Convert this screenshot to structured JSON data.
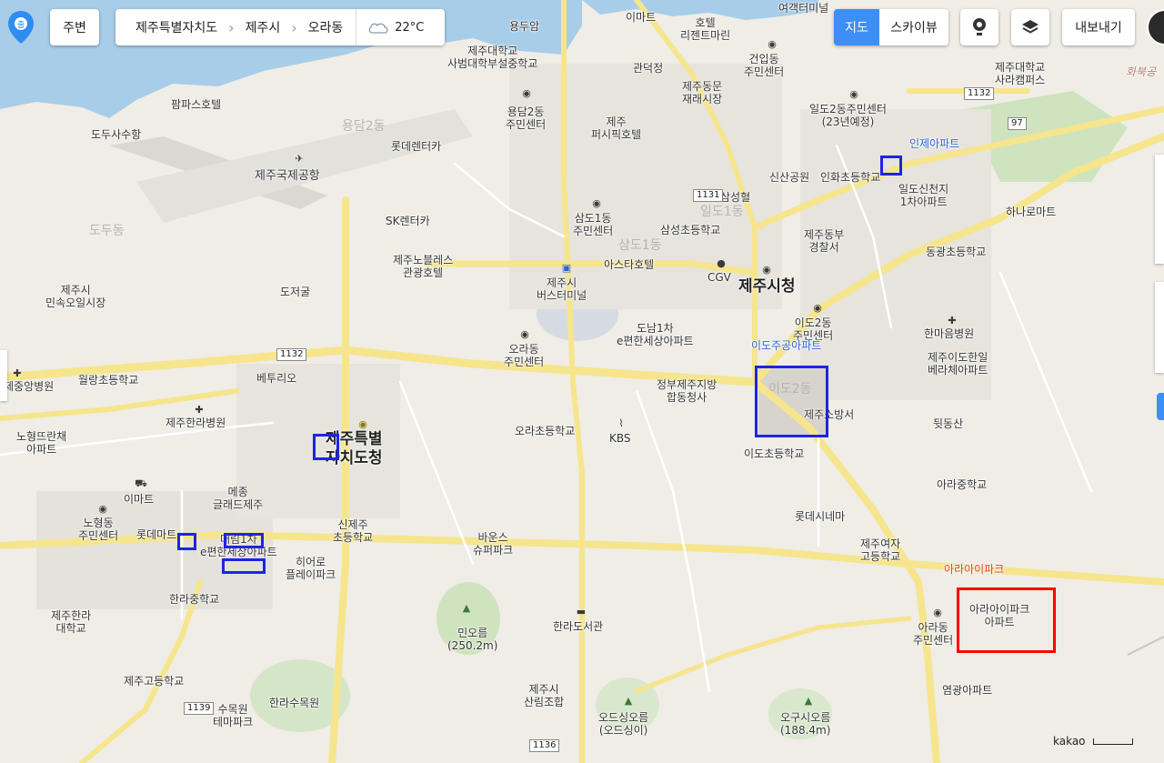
{
  "topbar": {
    "nearby_label": "주변",
    "breadcrumb": [
      "제주특별자치도",
      "제주시",
      "오라동"
    ],
    "weather_temp": "22°C",
    "map_mode_label": "지도",
    "skyview_label": "스카이뷰",
    "export_label": "내보내기"
  },
  "labels": {
    "yongdam_market": "용두암",
    "emart1": "이마트",
    "hotel_regent": "호텔\n리젠트마린",
    "yeogaek": "여객터미널",
    "jnu_school": "제주대학교\n사범대학부설중학교",
    "geonip": "건입동\n주민센터",
    "jnu_sara": "제주대학교\n사라캠퍼스",
    "palm_hotel": "팜파스호텔",
    "gwandeok": "관덕정",
    "dongmun": "제주동문\n재래시장",
    "yongdam2": "용담2동\n주민센터",
    "jeju_pacific": "제주\n퍼시픽호텔",
    "ildo2": "일도2동주민센터\n(23년예정)",
    "dodu_suhang": "도두사수항",
    "lotte_rentcar": "롯데렌터카",
    "inje_apt": "인제아파트",
    "jeju_airport": "제주국제공항",
    "sinsan_park": "신산공원",
    "inhwa_school": "인화초등학교",
    "ildo_sincheonji": "일도신천지\n1차아파트",
    "samsung_hyeol": "삼성혈",
    "sk_rentcar": "SK렌터카",
    "samdo1": "삼도1동\n주민센터",
    "samsung_school": "삼성초등학교",
    "hanaro": "하나로마트",
    "jeju_dongbu": "제주동부\n경찰서",
    "dodu_dong": "도두동",
    "nobless": "제주노블레스\n관광호텔",
    "asta_hotel": "아스타호텔",
    "cgv": "CGV",
    "jeju_city_hall": "제주시청",
    "donggwang_school": "동광초등학교",
    "jeju_market": "제주시\n민속오일시장",
    "dojeogul": "도저굴",
    "bus_terminal": "제주시\n버스터미널",
    "donam1": "도남1차\ne편한세상아파트",
    "ido2_center": "이도2동\n주민센터",
    "hanmaeum": "한마음병원",
    "idojugong": "이도주공아파트",
    "ora_center": "오라동\n주민센터",
    "ido_hanil": "제주이도한일\n베라체아파트",
    "jeju_yangbyeong": "제중앙병원",
    "wolnang_school": "월랑초등학교",
    "betulio": "베투리오",
    "gov_complex": "정부제주지방\n합동청사",
    "jeju_fire": "제주소방서",
    "jeju_hanra_hospital": "제주한라병원",
    "provincial_office": "제주특별\n자치도청",
    "ora_school": "오라초등학교",
    "kbs": "KBS",
    "ido_school": "이도초등학교",
    "dwitdongsan": "뒷동산",
    "nohyeong_ttuan": "노형뜨란채\n아파트",
    "mejong": "메종\n글래드제주",
    "ara_middle": "아라중학교",
    "emart2": "이마트",
    "nohyeong_center": "노형동\n주민센터",
    "lotte_mart": "롯데마트",
    "donam1_apt": "대림1차\ne편한세상아파트",
    "sinjeju_school": "신제주\n초등학교",
    "baunseu": "바운스\n슈퍼파크",
    "lotte_cinema": "롯데시네마",
    "jeju_girls_high": "제주여자\n고등학교",
    "hero_playpark": "히어로\n플레이파크",
    "ara_ipark_red": "아라아이파크",
    "hanra_middle": "한라중학교",
    "jeju_hanra_univ": "제주한라\n대학교",
    "mioreum": "민오름\n(250.2m)",
    "hanra_library": "한라도서관",
    "ara_center": "아라동\n주민센터",
    "ara_ipark_apt": "아라아이파크\n아파트",
    "jeju_goejeong": "제주고등학교",
    "sumok_theme": "수목원\n테마파크",
    "hanra_sumokwon": "한라수목원",
    "jeju_forest": "제주시\n산림조합",
    "odeungsing": "오드싱오름\n(오드싱이)",
    "ogusi": "오구시오름\n(188.4m)",
    "yeomgwang": "염광아파트",
    "hwabuk": "화북공",
    "yongdam2_faint": "용담2동",
    "samdo_faint": "삼도1동",
    "ido2_faint": "이도2동",
    "ildo_faint": "일도1동"
  },
  "roads": {
    "r1132a": "1132",
    "r97": "97",
    "r1131": "1131",
    "r1132b": "1132",
    "r1139": "1139",
    "r1136": "1136"
  },
  "attribution": "kakao"
}
